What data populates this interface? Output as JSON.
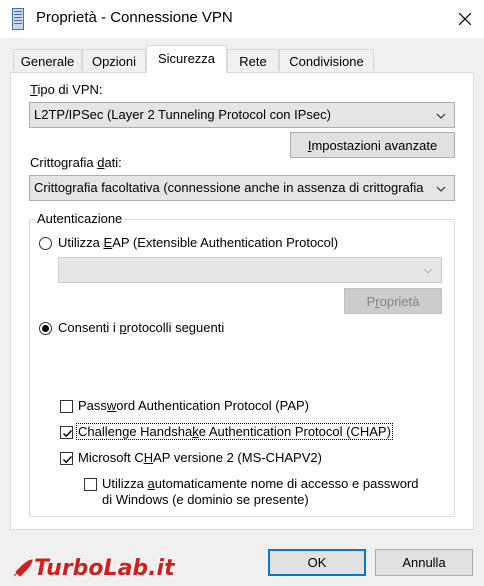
{
  "window": {
    "title": "Proprietà - Connessione VPN"
  },
  "tabs": [
    {
      "label": "Generale"
    },
    {
      "label": "Opzioni"
    },
    {
      "label": "Sicurezza"
    },
    {
      "label": "Rete"
    },
    {
      "label": "Condivisione"
    }
  ],
  "vpn_type": {
    "label_pre": "T",
    "label_rest": "ipo di VPN:",
    "value": "L2TP/IPSec (Layer 2 Tunneling Protocol con IPsec)"
  },
  "advanced_button": {
    "label_pre": "I",
    "label_rest": "mpostazioni avanzate"
  },
  "encryption": {
    "label_pre": "Crittografia ",
    "label_u": "d",
    "label_rest": "ati:",
    "value": "Crittografia facoltativa (connessione anche in assenza di crittografia"
  },
  "auth": {
    "group_label": "Autenticazione",
    "eap_radio": {
      "pre": "Utilizza ",
      "u": "E",
      "rest": "AP (Extensible Authentication Protocol)",
      "checked": false
    },
    "eap_properties_button": {
      "pre": "P",
      "u": "r",
      "rest": "oprietà"
    },
    "protocols_radio": {
      "pre": "Consenti i ",
      "u": "p",
      "rest": "rotocolli seguenti",
      "checked": true
    },
    "pap": {
      "pre": "Pass",
      "u": "w",
      "rest": "ord Authentication Protocol (PAP)",
      "checked": false
    },
    "chap": {
      "pre": "Challenge Handsha",
      "u": "k",
      "rest": "e Authentication Protocol (CHAP)",
      "checked": true
    },
    "mschap": {
      "pre": "Microsoft C",
      "u": "H",
      "rest": "AP versione 2 (MS-CHAPV2)",
      "checked": true
    },
    "auto_logon": {
      "line1_pre": "Utilizza ",
      "line1_u": "a",
      "line1_rest": "utomaticamente nome di accesso e password",
      "line2": "di Windows (e dominio se presente)",
      "checked": false
    }
  },
  "footer": {
    "ok_label": "OK",
    "cancel_label": "Annulla"
  },
  "watermark": {
    "brand": "TurboLab",
    "suffix": ".it"
  }
}
